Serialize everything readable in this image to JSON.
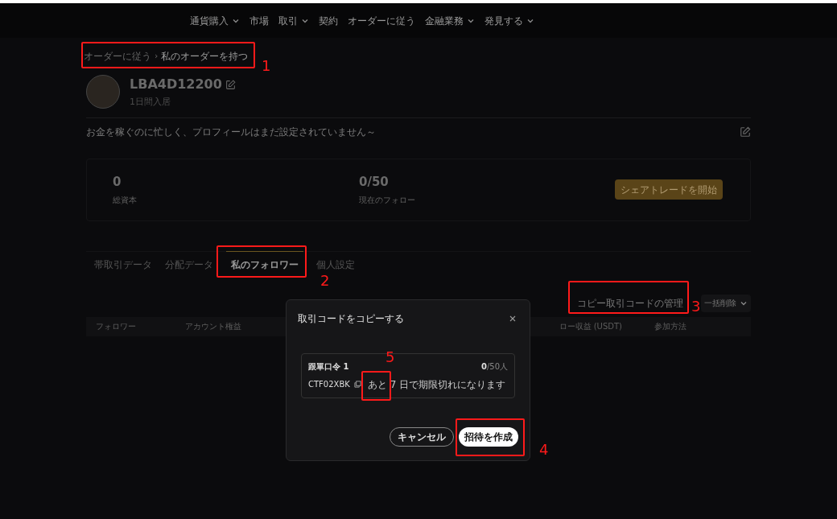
{
  "nav": [
    {
      "label": "通貨購入",
      "dropdown": true
    },
    {
      "label": "市場",
      "dropdown": false
    },
    {
      "label": "取引",
      "dropdown": true
    },
    {
      "label": "契約",
      "dropdown": false
    },
    {
      "label": "オーダーに従う",
      "dropdown": false
    },
    {
      "label": "金融業務",
      "dropdown": true
    },
    {
      "label": "発見する",
      "dropdown": true
    }
  ],
  "breadcrumb": [
    "オーダーに従う",
    "›",
    "私のオーダーを持つ"
  ],
  "profile": {
    "name": "LBA4D12200",
    "joined": "1日間入居",
    "bio": "お金を稼ぐのに忙しく、プロフィールはまだ設定されていません～"
  },
  "stats": [
    {
      "value": "0",
      "label": "総資本"
    },
    {
      "value": "0/50",
      "label": "現在のフォロー"
    }
  ],
  "share_button": "シェアトレードを開始",
  "tabs": [
    {
      "label": "帯取引データ",
      "selected": false
    },
    {
      "label": "分配データ",
      "selected": false
    },
    {
      "label": "私のフォロワー",
      "selected": true
    },
    {
      "label": "個人設定",
      "selected": false
    }
  ],
  "manage_button": "コピー取引コードの管理",
  "bulk_delete": "一括削除",
  "columns": [
    "フォロワー",
    "アカウント権益",
    "ロー収益 (USDT)",
    "参加方法"
  ],
  "modal": {
    "title": "取引コードをコピーする",
    "code_title": "跟單口令 1",
    "count_used": "0",
    "count_total": "/50人",
    "code": "CTF02XBK",
    "expiry": "あと 7 日で期限切れになります",
    "cancel": "キャンセル",
    "create": "招待を作成"
  },
  "annotations": [
    "1",
    "2",
    "3",
    "4",
    "5"
  ]
}
